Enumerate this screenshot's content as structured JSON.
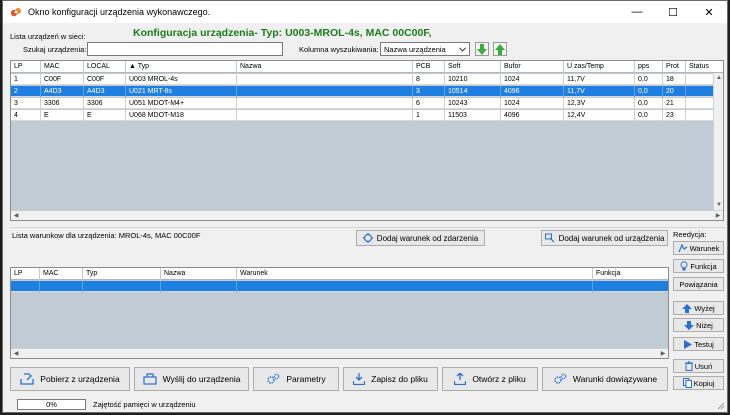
{
  "window": {
    "title": "Okno konfiguracji urządzenia wykonawczego.",
    "controls": {
      "minimize": "—",
      "maximize": "☐",
      "close": "✕"
    }
  },
  "heading": "Konfiguracja urządzenia- Typ: U003-MROL-4s, MAC 00C00F,",
  "devices_section": {
    "label": "Lista urządzeń w sieci:",
    "search_label": "Szukaj urządzenia:",
    "search_value": "",
    "search_column_label": "Kolumna wyszukiwania:",
    "search_column_value": "Nazwa urządzenia",
    "columns": [
      "LP",
      "MAC",
      "LOCAL",
      "▲ Typ",
      "Nazwa",
      "PCB",
      "Soft",
      "Bufor",
      "U zas/Temp",
      "pps",
      "Prot",
      "Status"
    ],
    "rows": [
      [
        "1",
        "C00F",
        "C00F",
        "U003 MROL-4s",
        "",
        "8",
        "10210",
        "1024",
        "11,7V",
        "0,0",
        "18",
        ""
      ],
      [
        "2",
        "A4D3",
        "A4D3",
        "U021 MRT-8s",
        "",
        "3",
        "10514",
        "4096",
        "11,7V",
        "0,0",
        "20",
        ""
      ],
      [
        "3",
        "3306",
        "3306",
        "U051 MDOT-M4+",
        "",
        "6",
        "10243",
        "1024",
        "12,3V",
        "0,0",
        "21",
        ""
      ],
      [
        "4",
        "E",
        "E",
        "U068 MDOT-M18",
        "",
        "1",
        "11503",
        "4096",
        "12,4V",
        "0,0",
        "23",
        ""
      ]
    ],
    "selected_row": 1
  },
  "conditions_section": {
    "label": "Lista warunkow dla urządzenia: MROL-4s, MAC 00C00F",
    "add_from_event": "Dodaj warunek od zdarzenia",
    "add_from_device": "Dodaj warunek od urządzenia",
    "columns": [
      "LP",
      "MAC",
      "Typ",
      "Nazwa",
      "Warunek",
      "Funkcja"
    ]
  },
  "side_panel": {
    "title": "Reedycja:",
    "buttons": {
      "warunek": "Warunek",
      "funkcja": "Funkcja",
      "powiazania": "Powiązania",
      "wyzej": "Wyżej",
      "nizej": "Niżej",
      "testuj": "Testuj",
      "usun": "Usuń",
      "kopiuj": "Kopiuj"
    }
  },
  "bottom_buttons": {
    "pobierz": "Pobierz z urządzenia",
    "wyslij": "Wyślij do urządzenia",
    "parametry": "Parametry",
    "zapisz": "Zapisz do pliku",
    "otworz": "Otwórz z pliku",
    "warunki": "Warunki dowiązywane"
  },
  "status": {
    "progress_text": "0%",
    "progress_value": 0,
    "memory_label": "Zajętość pamięci w urządzeniu"
  },
  "colors": {
    "heading_green": "#1c7a1c",
    "selection_blue": "#1f7fe0",
    "grid_background": "#c0cbd6"
  }
}
